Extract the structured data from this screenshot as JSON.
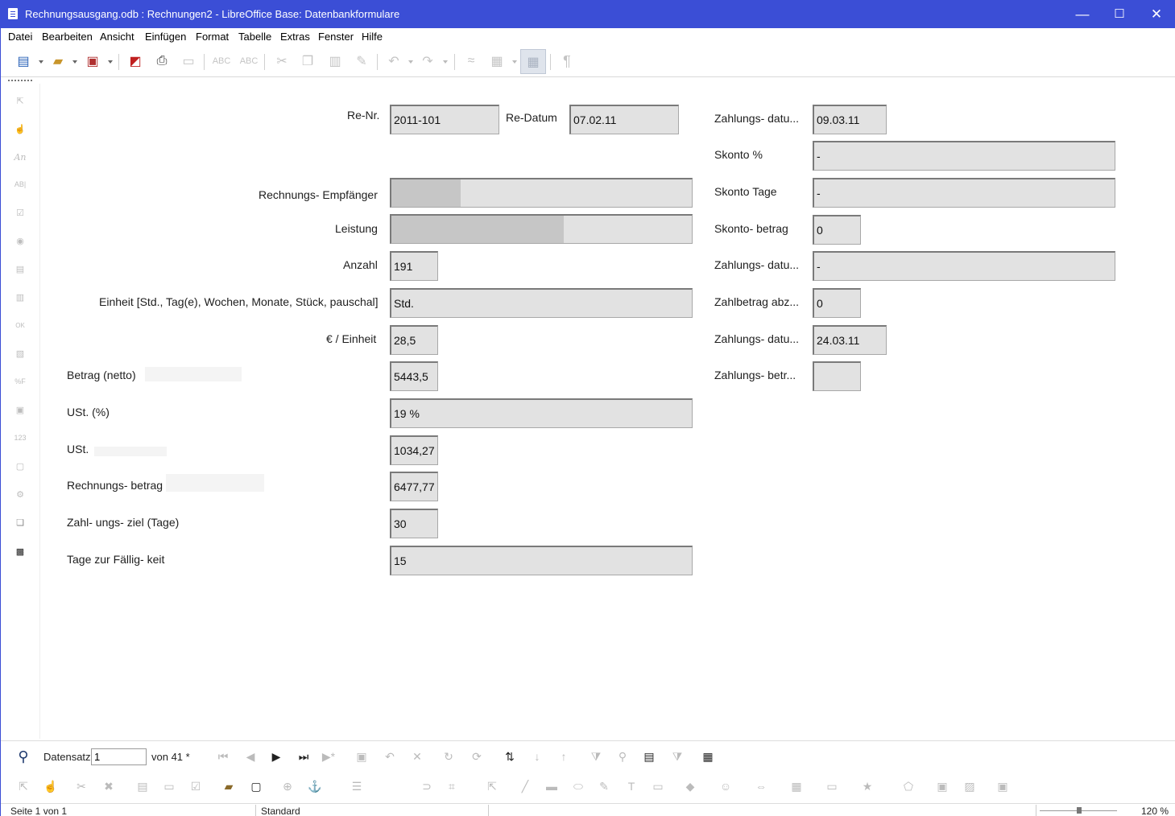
{
  "window": {
    "title": "Rechnungsausgang.odb : Rechnungen2 - LibreOffice Base: Datenbankformulare",
    "minimize": "—",
    "maximize": "☐",
    "close": "✕"
  },
  "menu": [
    "Datei",
    "Bearbeiten",
    "Ansicht",
    "Einfügen",
    "Format",
    "Tabelle",
    "Extras",
    "Fenster",
    "Hilfe"
  ],
  "toolbar_icons": [
    "new-document-icon",
    "open-icon",
    "save-icon",
    "export-pdf-icon",
    "print-icon",
    "print-preview-icon",
    "spellcheck-icon",
    "autospellcheck-icon",
    "cut-icon",
    "copy-icon",
    "paste-icon",
    "clone-formatting-icon",
    "undo-icon",
    "redo-icon",
    "hyperlink-icon",
    "table-icon",
    "grid-icon",
    "formatting-marks-icon"
  ],
  "form": {
    "re_nr": {
      "label": "Re-Nr.",
      "value": "2011-101"
    },
    "re_datum": {
      "label": "Re-Datum",
      "value": "07.02.11"
    },
    "empfaenger": {
      "label": "Rechnungs- Empfänger",
      "value": ""
    },
    "leistung": {
      "label": "Leistung",
      "value": ""
    },
    "anzahl": {
      "label": "Anzahl",
      "value": "191"
    },
    "einheit": {
      "label": "Einheit [Std., Tag(e), Wochen, Monate, Stück, pauschal]",
      "value": "Std."
    },
    "euro_einheit": {
      "label": "€ / Einheit",
      "value": "28,5"
    },
    "betrag_netto": {
      "label": "Betrag (netto)",
      "value": "5443,5"
    },
    "ust_prozent": {
      "label": "USt. (%)",
      "value": "19 %"
    },
    "ust": {
      "label": "USt.",
      "value": "1034,27"
    },
    "rechnungsbetrag": {
      "label": "Rechnungs- betrag",
      "value": "6477,77"
    },
    "zahlungsziel": {
      "label": "Zahl- ungs- ziel  (Tage)",
      "value": "30"
    },
    "tage_faelligkeit": {
      "label": "Tage zur Fällig- keit",
      "value": "15"
    },
    "zahlungsdatum1": {
      "label": "Zahlungs- datu...",
      "value": "09.03.11"
    },
    "skonto_prozent": {
      "label": "Skonto %",
      "value": "-"
    },
    "skonto_tage": {
      "label": "Skonto Tage",
      "value": "-"
    },
    "skonto_betrag": {
      "label": "Skonto- betrag",
      "value": "0"
    },
    "zahlungsdatum2": {
      "label": "Zahlungs- datu...",
      "value": "-"
    },
    "zahlbetrag_abz": {
      "label": "Zahlbetrag abz...",
      "value": "0"
    },
    "zahlungsdatum3": {
      "label": "Zahlungs- datu...",
      "value": "24.03.11"
    },
    "zahlungsbetrag": {
      "label": "Zahlungs- betr...",
      "value": ""
    }
  },
  "navigation": {
    "record_label": "Datensatz",
    "record_value": "1",
    "of_label": "von  41 *"
  },
  "status": {
    "page": "Seite 1 von 1",
    "style": "Standard",
    "zoom": "120 %"
  }
}
